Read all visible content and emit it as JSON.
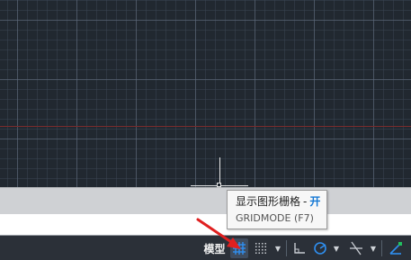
{
  "tooltip": {
    "title": "显示图形栅格",
    "separator": "-",
    "state": "开",
    "subtitle": "GRIDMODE (F7)"
  },
  "status_bar": {
    "model_tab_label": "模型",
    "buttons": [
      "grid-icon",
      "snap-icon",
      "ortho-icon",
      "polar-icon",
      "osnap-icon",
      "object-track-icon"
    ]
  },
  "colors": {
    "canvas_bg": "#212830",
    "grid_major": "#626e80",
    "x_axis": "#7a2c2c",
    "tooltip_state": "#1478d4",
    "annotation_arrow": "#e02020",
    "active_button_bg": "#3f4c5e"
  }
}
